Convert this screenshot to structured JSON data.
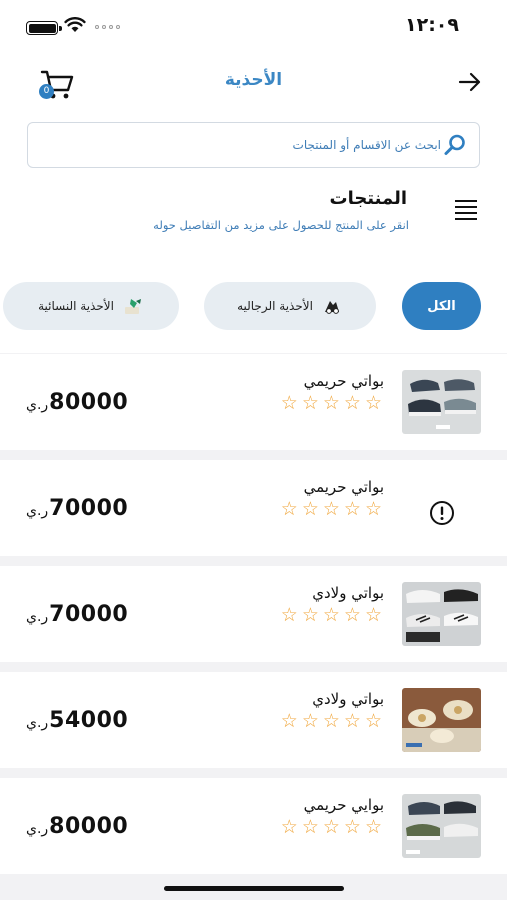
{
  "status": {
    "time": "١٢:٠٩"
  },
  "header": {
    "title": "الأحذية",
    "cart_count": "0"
  },
  "search": {
    "placeholder": "ابحث عن الاقسام أو المنتجات"
  },
  "section": {
    "title": "المنتجات",
    "hint": "انقر على المنتج للحصول على مزيد من التفاصيل حوله"
  },
  "categories": [
    {
      "label": "الكل",
      "selected": true
    },
    {
      "label": "الأحذية الرجاليه",
      "selected": false
    },
    {
      "label": "الأحذية النسائية",
      "selected": false
    }
  ],
  "products": [
    {
      "name": "بواتي حريمي",
      "price": "80000",
      "currency": "ر.ي",
      "rating": 0,
      "max_rating": 5,
      "image": "sneakers-photo"
    },
    {
      "name": "بواتي حريمي",
      "price": "70000",
      "currency": "ر.ي",
      "rating": 0,
      "max_rating": 5,
      "image": "missing-image-icon"
    },
    {
      "name": "بواتي ولادي",
      "price": "70000",
      "currency": "ر.ي",
      "rating": 0,
      "max_rating": 5,
      "image": "sneakers-photo"
    },
    {
      "name": "بواتي ولادي",
      "price": "54000",
      "currency": "ر.ي",
      "rating": 0,
      "max_rating": 5,
      "image": "kids-shoes-photo"
    },
    {
      "name": "بوايي حريمي",
      "price": "80000",
      "currency": "ر.ي",
      "rating": 0,
      "max_rating": 5,
      "image": "sneakers-photo"
    }
  ],
  "colors": {
    "accent": "#2f7fc1",
    "star": "#f0a63b",
    "chip_bg": "#e7edf2"
  }
}
